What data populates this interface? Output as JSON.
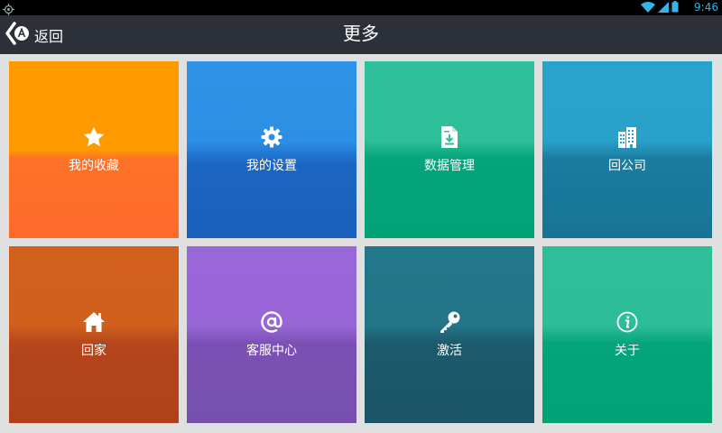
{
  "statusbar": {
    "time": "9:46",
    "icons": [
      "gps-icon",
      "wifi-icon",
      "signal-icon",
      "battery-icon"
    ]
  },
  "header": {
    "back_label": "返回",
    "title": "更多"
  },
  "tiles": [
    {
      "id": "favorites",
      "label": "我的收藏",
      "icon": "star-icon"
    },
    {
      "id": "settings",
      "label": "我的设置",
      "icon": "gear-icon"
    },
    {
      "id": "data-management",
      "label": "数据管理",
      "icon": "document-download-icon"
    },
    {
      "id": "go-to-company",
      "label": "回公司",
      "icon": "building-icon"
    },
    {
      "id": "go-home",
      "label": "回家",
      "icon": "home-icon"
    },
    {
      "id": "customer-service",
      "label": "客服中心",
      "icon": "at-sign-icon"
    },
    {
      "id": "activate",
      "label": "激活",
      "icon": "key-icon"
    },
    {
      "id": "about",
      "label": "关于",
      "icon": "info-icon"
    }
  ],
  "colors": {
    "status_accent": "#33b5e5",
    "titlebar": "#2c3038",
    "background": "#e0e0e0"
  }
}
